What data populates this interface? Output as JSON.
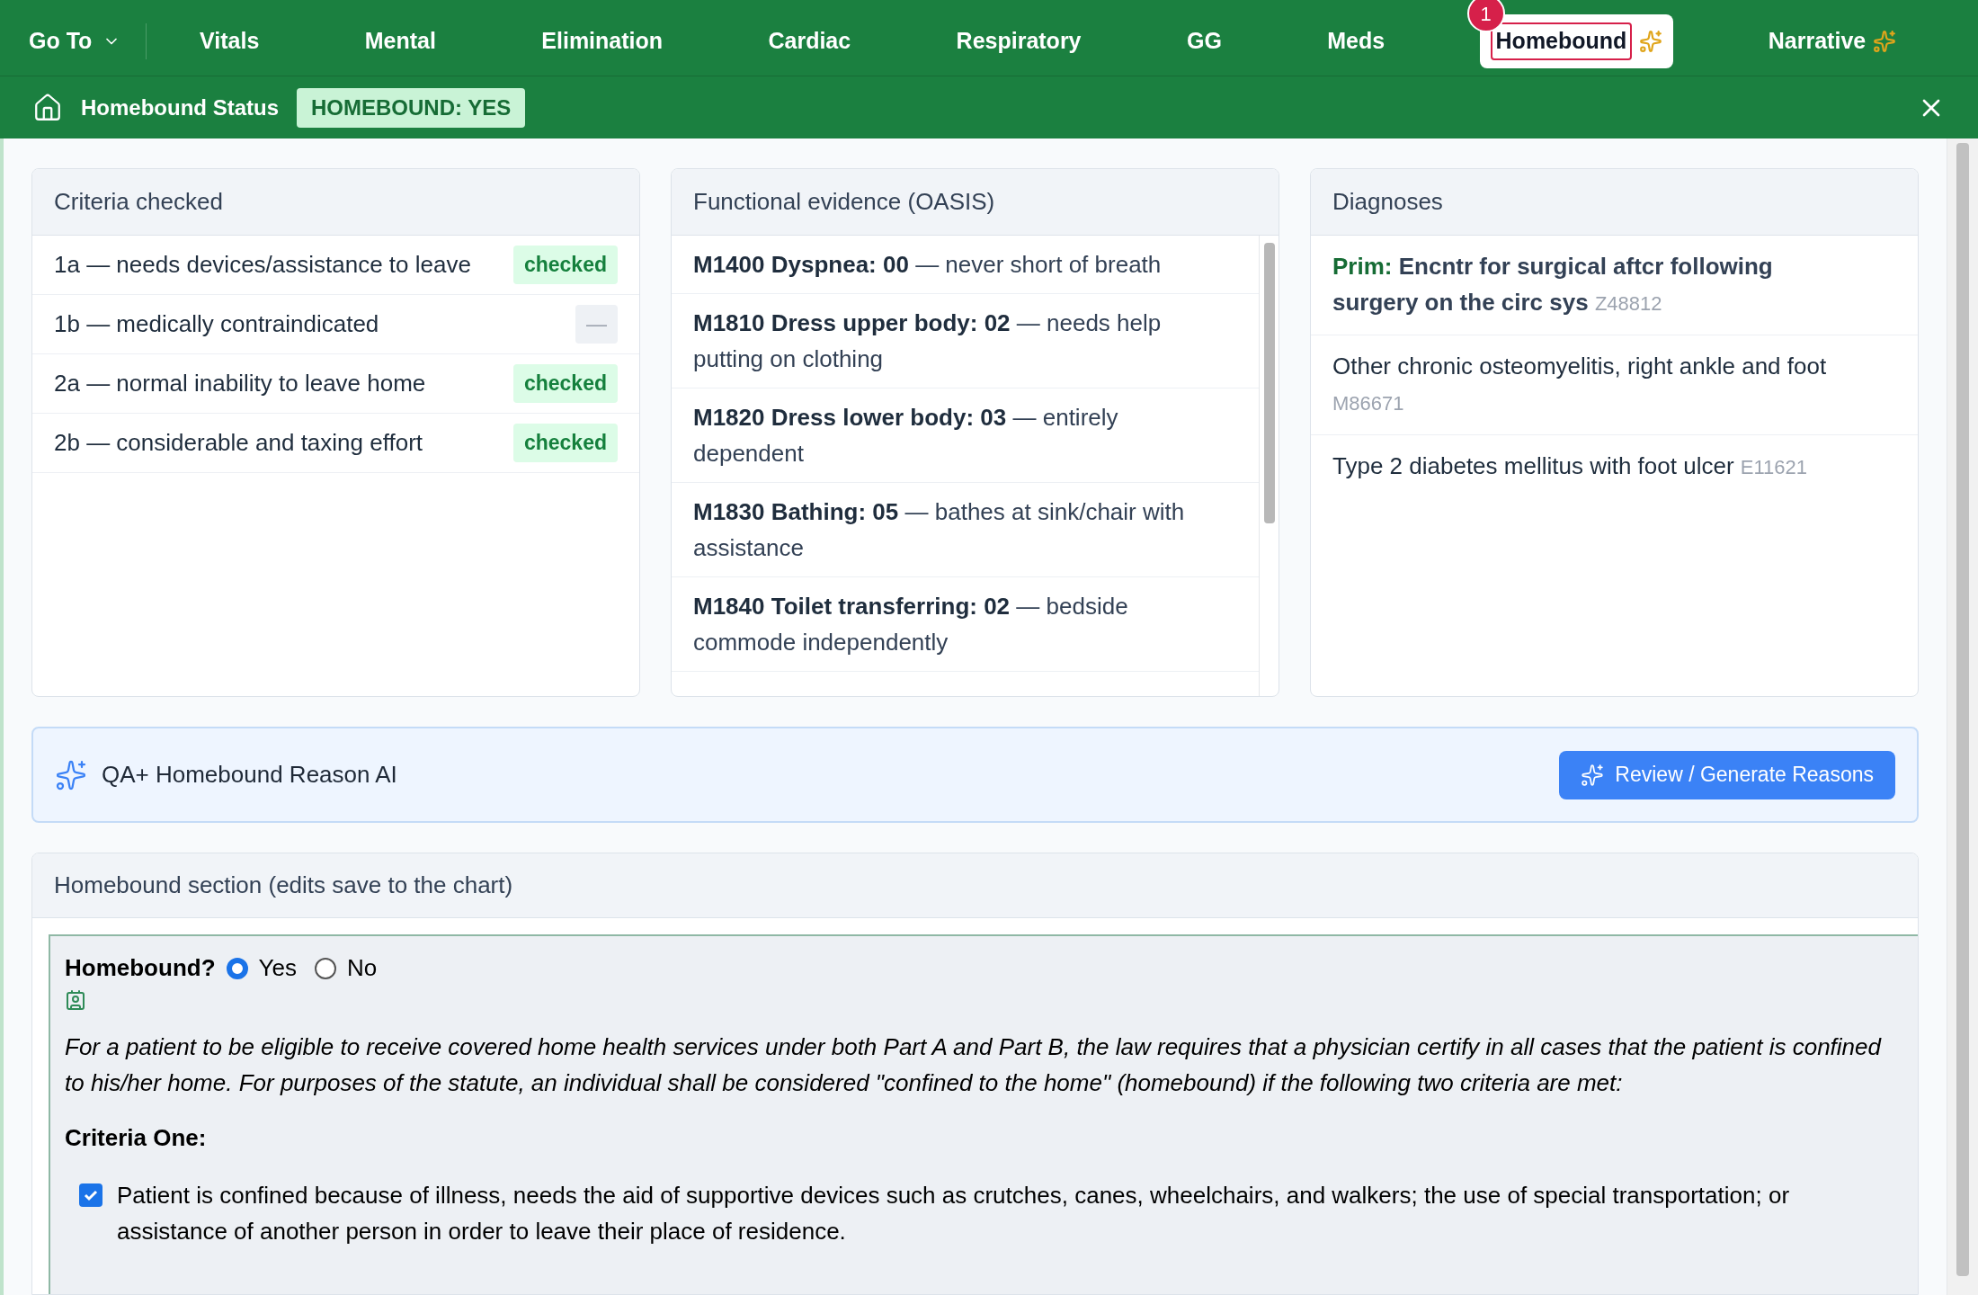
{
  "nav": {
    "goto": "Go To",
    "items": [
      {
        "label": "Vitals",
        "selected": false,
        "ai": false
      },
      {
        "label": "Mental",
        "selected": false,
        "ai": false
      },
      {
        "label": "Elimination",
        "selected": false,
        "ai": false
      },
      {
        "label": "Cardiac",
        "selected": false,
        "ai": false
      },
      {
        "label": "Respiratory",
        "selected": false,
        "ai": false
      },
      {
        "label": "GG",
        "selected": false,
        "ai": false
      },
      {
        "label": "Meds",
        "selected": false,
        "ai": false
      },
      {
        "label": "Homebound",
        "selected": true,
        "ai": true,
        "badge": "1"
      },
      {
        "label": "Narrative",
        "selected": false,
        "ai": true
      }
    ]
  },
  "status_bar": {
    "title": "Homebound Status",
    "badge": "HOMEBOUND: YES"
  },
  "criteria": {
    "title": "Criteria checked",
    "items": [
      {
        "label": "1a — needs devices/assistance to leave",
        "checked": true,
        "tag": "checked"
      },
      {
        "label": "1b — medically contraindicated",
        "checked": false,
        "tag": "—"
      },
      {
        "label": "2a — normal inability to leave home",
        "checked": true,
        "tag": "checked"
      },
      {
        "label": "2b — considerable and taxing effort",
        "checked": true,
        "tag": "checked"
      }
    ]
  },
  "oasis": {
    "title": "Functional evidence (OASIS)",
    "items": [
      {
        "text": "**M1400 Dyspnea: 00** — never short of breath"
      },
      {
        "text": "**M1810 Dress upper body: 02** — needs help putting on clothing"
      },
      {
        "text": "**M1820 Dress lower body: 03** — entirely dependent"
      },
      {
        "text": "**M1830 Bathing: 05** — bathes at sink/chair with assistance"
      },
      {
        "text": "**M1840 Toilet transferring: 02** — bedside commode independently"
      }
    ]
  },
  "diagnoses": {
    "title": "Diagnoses",
    "items": [
      {
        "prefix": "Prim:",
        "name": "Encntr for surgical aftcr following surgery on the circ sys",
        "code": "Z48812",
        "primary": true
      },
      {
        "name": "Other chronic osteomyelitis, right ankle and foot",
        "code": "M86671",
        "primary": false
      },
      {
        "name": "Type 2 diabetes mellitus with foot ulcer",
        "code": "E11621",
        "primary": false
      }
    ]
  },
  "qa": {
    "title": "QA+ Homebound Reason AI",
    "button": "Review / Generate Reasons"
  },
  "section": {
    "title": "Homebound section (edits save to the chart)",
    "question": "Homebound?",
    "options": [
      {
        "label": "Yes",
        "selected": true
      },
      {
        "label": "No",
        "selected": false
      }
    ],
    "intro": "For a patient to be eligible to receive covered home health services under both Part A and Part B, the law requires that a physician certify in all cases that the patient is confined to his/her home. For purposes of the statute, an individual shall be considered \"confined to the home\" (homebound) if the following two criteria are met:",
    "heading": "Criteria One:",
    "checks": [
      {
        "label": "Patient is confined because of illness, needs the aid of supportive devices such as crutches, canes, wheelchairs, and walkers; the use of special transportation; or assistance of another person in order to leave their place of residence.",
        "checked": true
      }
    ]
  }
}
